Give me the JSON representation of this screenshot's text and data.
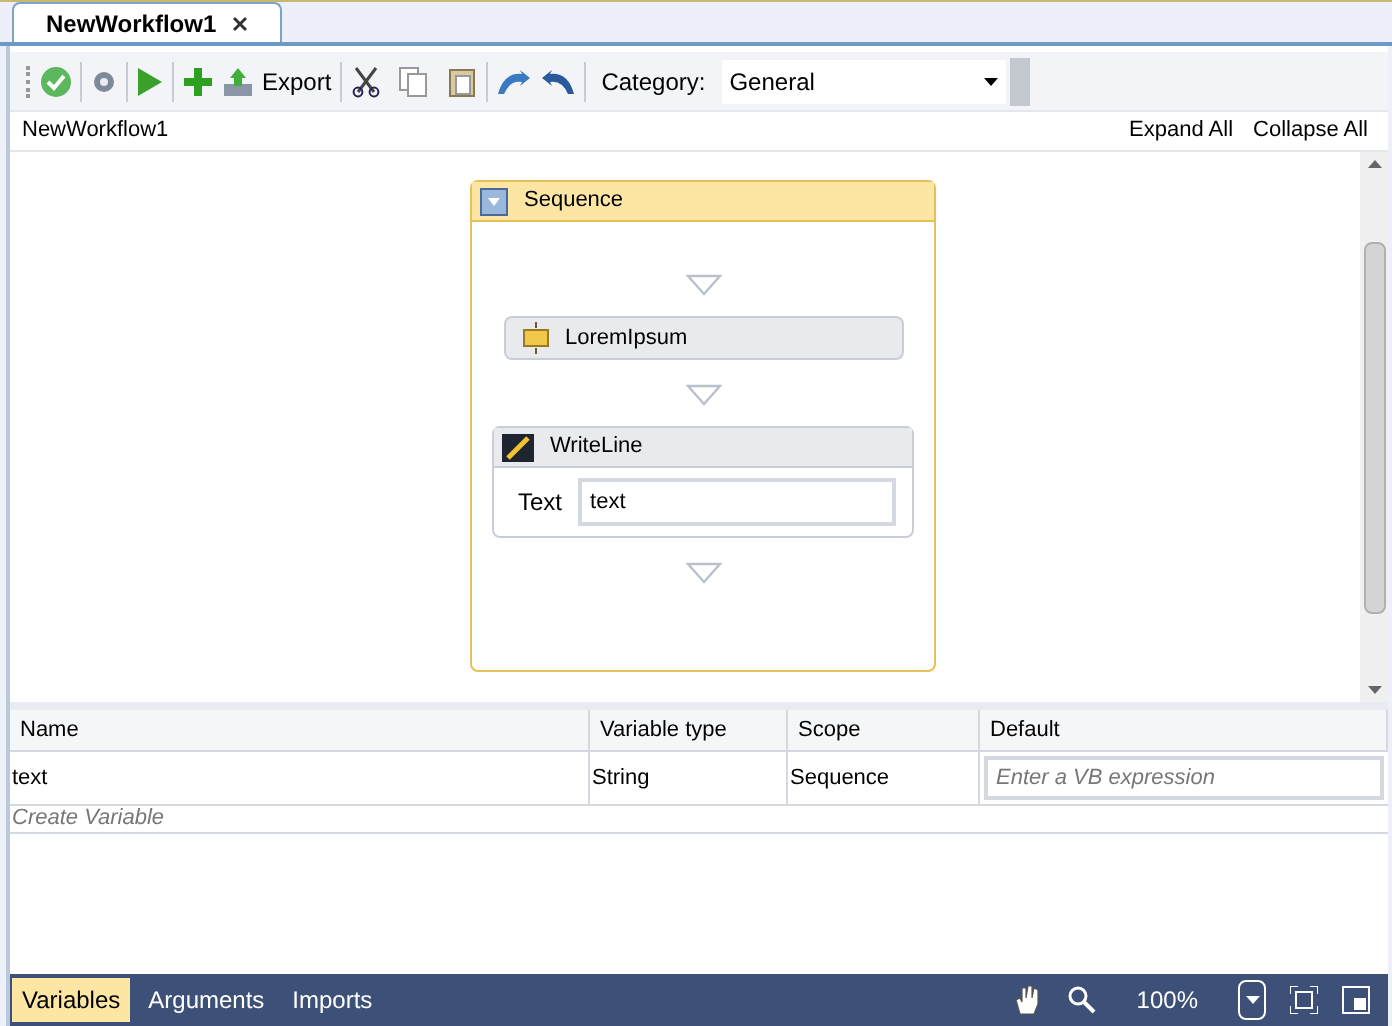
{
  "document_tabs": [
    {
      "label": "NewWorkflow1",
      "selected": true
    }
  ],
  "toolbar": {
    "export_label": "Export",
    "category_label": "Category:",
    "category_value": "General"
  },
  "breadcrumb": "NewWorkflow1",
  "expand_all": "Expand All",
  "collapse_all": "Collapse All",
  "sequence": {
    "title": "Sequence",
    "activities": [
      {
        "kind": "collapsed",
        "title": "LoremIpsum"
      },
      {
        "kind": "writeline",
        "title": "WriteLine",
        "field_label": "Text",
        "field_value": "text"
      }
    ]
  },
  "variables": {
    "columns": [
      "Name",
      "Variable type",
      "Scope",
      "Default"
    ],
    "rows": [
      {
        "name": "text",
        "type": "String",
        "scope": "Sequence",
        "default_placeholder": "Enter a VB expression"
      }
    ],
    "create_label": "Create Variable"
  },
  "bottom_tabs": [
    {
      "label": "Variables",
      "selected": true
    },
    {
      "label": "Arguments",
      "selected": false
    },
    {
      "label": "Imports",
      "selected": false
    }
  ],
  "zoom": "100%"
}
